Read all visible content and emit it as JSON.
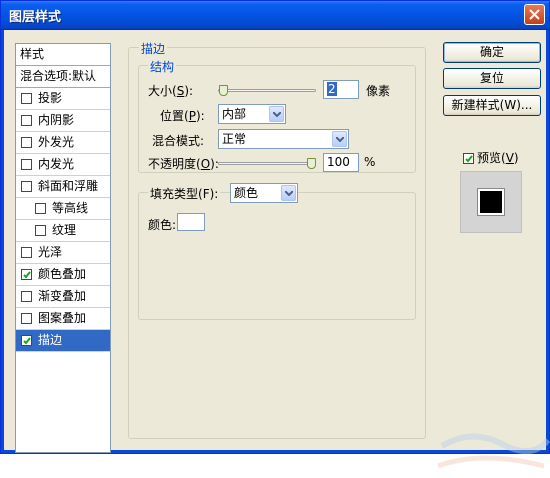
{
  "window": {
    "title": "图层样式"
  },
  "style_list": {
    "header": "样式",
    "blend_options": "混合选项:默认",
    "items": [
      {
        "label": "投影",
        "checked": false,
        "indent": false,
        "selected": false
      },
      {
        "label": "内阴影",
        "checked": false,
        "indent": false,
        "selected": false
      },
      {
        "label": "外发光",
        "checked": false,
        "indent": false,
        "selected": false
      },
      {
        "label": "内发光",
        "checked": false,
        "indent": false,
        "selected": false
      },
      {
        "label": "斜面和浮雕",
        "checked": false,
        "indent": false,
        "selected": false
      },
      {
        "label": "等高线",
        "checked": false,
        "indent": true,
        "selected": false
      },
      {
        "label": "纹理",
        "checked": false,
        "indent": true,
        "selected": false
      },
      {
        "label": "光泽",
        "checked": false,
        "indent": false,
        "selected": false
      },
      {
        "label": "颜色叠加",
        "checked": true,
        "indent": false,
        "selected": false
      },
      {
        "label": "渐变叠加",
        "checked": false,
        "indent": false,
        "selected": false
      },
      {
        "label": "图案叠加",
        "checked": false,
        "indent": false,
        "selected": false
      },
      {
        "label": "描边",
        "checked": true,
        "indent": false,
        "selected": true
      }
    ]
  },
  "stroke": {
    "group_title": "描边",
    "structure_title": "结构",
    "size_label": "大小",
    "size_key": "S",
    "size_value": "2",
    "size_unit": "像素",
    "position_label": "位置",
    "position_key": "P",
    "position_value": "内部",
    "blend_mode_label": "混合模式",
    "blend_mode_value": "正常",
    "opacity_label": "不透明度",
    "opacity_key": "O",
    "opacity_value": "100",
    "opacity_unit": "%",
    "opacity_level": 1.0,
    "size_level": 0.01,
    "fill_type_label": "填充类型",
    "fill_type_key": "F",
    "fill_type_value": "颜色",
    "color_label": "颜色:",
    "color_value": "#ffffff"
  },
  "buttons": {
    "ok": "确定",
    "reset": "复位",
    "new_style": "新建样式(W)..."
  },
  "preview": {
    "label": "预览",
    "key": "V",
    "checked": true
  }
}
